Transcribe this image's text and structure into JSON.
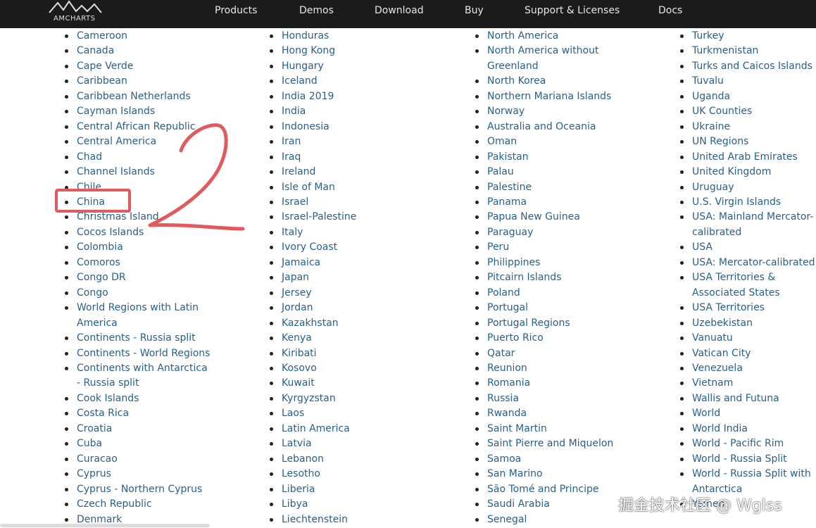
{
  "header": {
    "logo_text": "AMCHARTS",
    "nav": [
      "Products",
      "Demos",
      "Download",
      "Buy",
      "Support & Licenses",
      "Docs"
    ]
  },
  "lists": {
    "col1": [
      "Cameroon",
      "Canada",
      "Cape Verde",
      "Caribbean",
      "Caribbean Netherlands",
      "Cayman Islands",
      "Central African Republic",
      "Central America",
      "Chad",
      "Channel Islands",
      "Chile",
      "China",
      "Christmas Island",
      "Cocos Islands",
      "Colombia",
      "Comoros",
      "Congo DR",
      "Congo",
      "World Regions with Latin America",
      "Continents - Russia split",
      "Continents - World Regions",
      "Continents with Antarctica - Russia split",
      "Cook Islands",
      "Costa Rica",
      "Croatia",
      "Cuba",
      "Curacao",
      "Cyprus",
      "Cyprus - Northern Cyprus",
      "Czech Republic",
      "Denmark"
    ],
    "col2": [
      "Honduras",
      "Hong Kong",
      "Hungary",
      "Iceland",
      "India 2019",
      "India",
      "Indonesia",
      "Iran",
      "Iraq",
      "Ireland",
      "Isle of Man",
      "Israel",
      "Israel-Palestine",
      "Italy",
      "Ivory Coast",
      "Jamaica",
      "Japan",
      "Jersey",
      "Jordan",
      "Kazakhstan",
      "Kenya",
      "Kiribati",
      "Kosovo",
      "Kuwait",
      "Kyrgyzstan",
      "Laos",
      "Latin America",
      "Latvia",
      "Lebanon",
      "Lesotho",
      "Liberia",
      "Libya",
      "Liechtenstein"
    ],
    "col3": [
      "North America",
      "North America without Greenland",
      "North Korea",
      "Northern Mariana Islands",
      "Norway",
      "Australia and Oceania",
      "Oman",
      "Pakistan",
      "Palau",
      "Palestine",
      "Panama",
      "Papua New Guinea",
      "Paraguay",
      "Peru",
      "Philippines",
      "Pitcairn Islands",
      "Poland",
      "Portugal",
      "Portugal Regions",
      "Puerto Rico",
      "Qatar",
      "Reunion",
      "Romania",
      "Russia",
      "Rwanda",
      "Saint Martin",
      "Saint Pierre and Miquelon",
      "Samoa",
      "San Marino",
      "São Tomé and Principe",
      "Saudi Arabia",
      "Senegal"
    ],
    "col4": [
      "Turkey",
      "Turkmenistan",
      "Turks and Caicos Islands",
      "Tuvalu",
      "Uganda",
      "UK Counties",
      "Ukraine",
      "UN Regions",
      "United Arab Emirates",
      "United Kingdom",
      "Uruguay",
      "U.S. Virgin Islands",
      "USA: Mainland Mercator-calibrated",
      "USA",
      "USA: Mercator-calibrated",
      "USA Territories & Associated States",
      "USA Territories",
      "Uzebekistan",
      "Vanuatu",
      "Vatican City",
      "Venezuela",
      "Vietnam",
      "Wallis and Futuna",
      "World",
      "World India",
      "World - Pacific Rim",
      "World - Russia Split",
      "World - Russia Split with Antarctica",
      "Yemen"
    ]
  },
  "annotation": {
    "number": "2"
  },
  "watermark": "掘金技术社区 @ Wglss",
  "colors": {
    "link": "#2a5f8a",
    "header_bg": "#1b1b1b",
    "annotation": "#e25a5f"
  }
}
